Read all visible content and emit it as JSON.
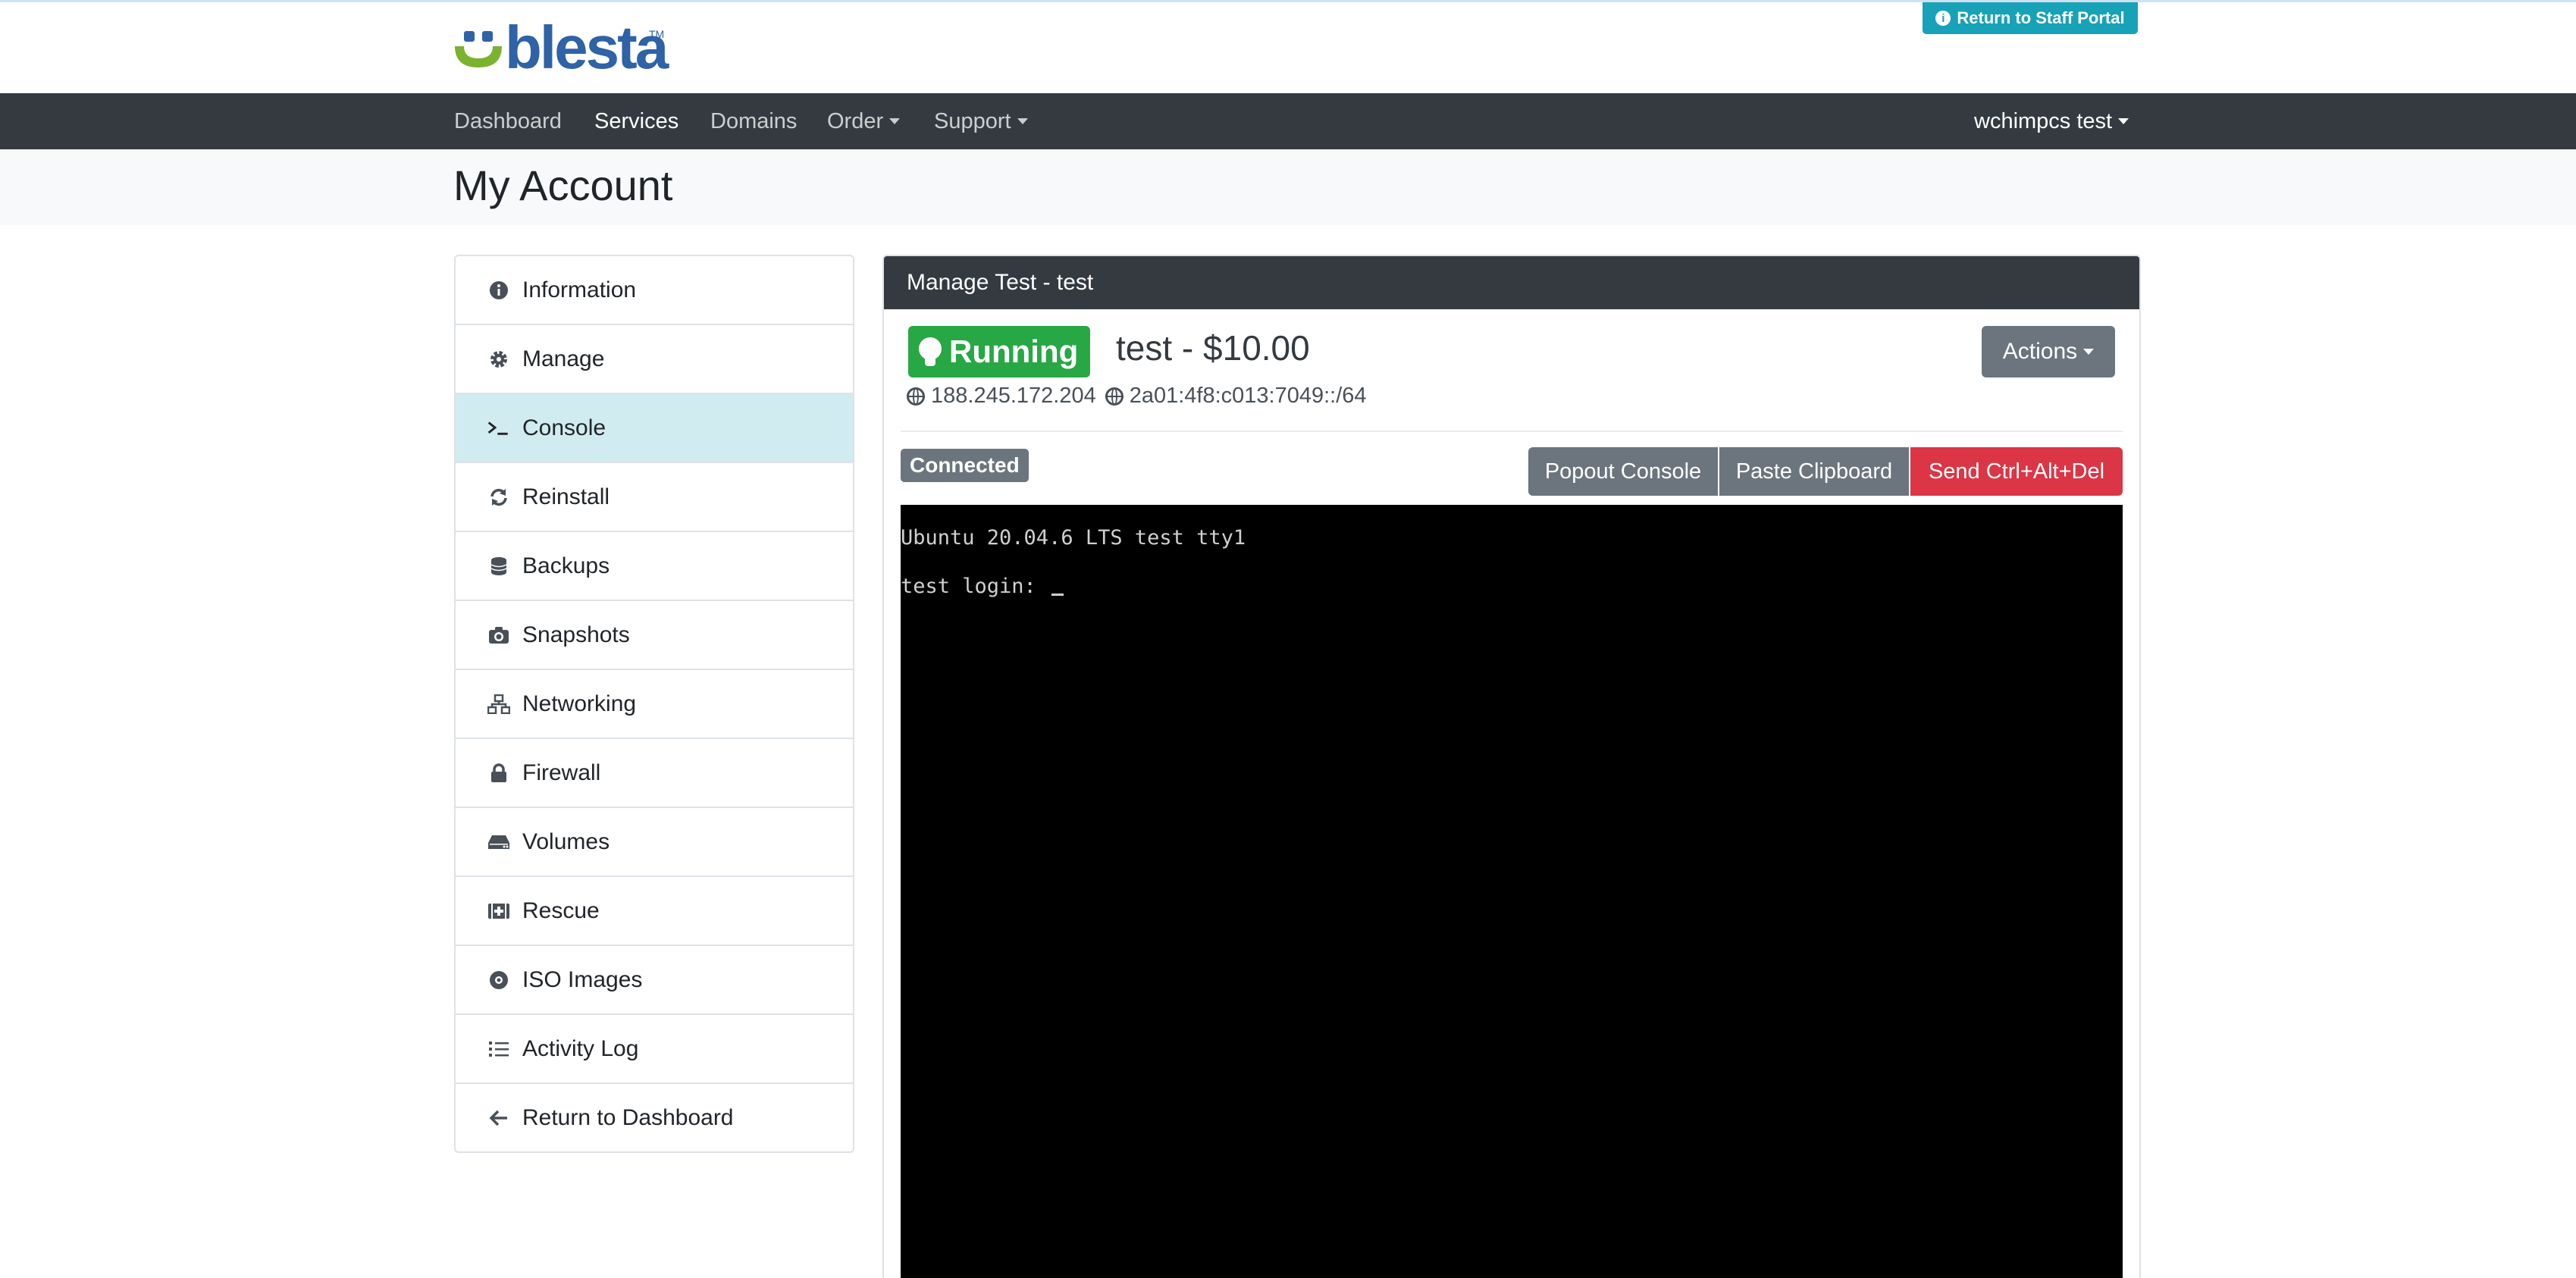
{
  "header": {
    "logo_text": "blesta",
    "logo_tm": "TM",
    "staff_portal_label": "Return to Staff Portal",
    "brand_colors": {
      "logo_blue": "#2f62a6",
      "logo_green": "#7ab32e",
      "staff_button": "#17a2b8"
    }
  },
  "nav": {
    "items": [
      {
        "label": "Dashboard"
      },
      {
        "label": "Services"
      },
      {
        "label": "Domains"
      },
      {
        "label": "Order"
      },
      {
        "label": "Support"
      }
    ],
    "user_label": "wchimpcs test"
  },
  "page": {
    "title": "My Account"
  },
  "sidebar": {
    "items": [
      {
        "label": "Information",
        "icon": "info-circle-icon"
      },
      {
        "label": "Manage",
        "icon": "gear-icon"
      },
      {
        "label": "Console",
        "icon": "terminal-icon"
      },
      {
        "label": "Reinstall",
        "icon": "sync-icon"
      },
      {
        "label": "Backups",
        "icon": "database-icon"
      },
      {
        "label": "Snapshots",
        "icon": "camera-icon"
      },
      {
        "label": "Networking",
        "icon": "network-icon"
      },
      {
        "label": "Firewall",
        "icon": "lock-icon"
      },
      {
        "label": "Volumes",
        "icon": "hdd-icon"
      },
      {
        "label": "Rescue",
        "icon": "first-aid-icon"
      },
      {
        "label": "ISO Images",
        "icon": "compact-disc-icon"
      },
      {
        "label": "Activity Log",
        "icon": "list-icon"
      },
      {
        "label": "Return to Dashboard",
        "icon": "arrow-left-icon"
      }
    ],
    "active": "Console"
  },
  "panel": {
    "header": "Manage Test - test",
    "status": "Running",
    "service_title": "test - $10.00",
    "ipv4": "188.245.172.204",
    "ipv6": "2a01:4f8:c013:7049::/64",
    "actions_label": "Actions",
    "colors": {
      "running": "#28a745",
      "danger": "#dc3545",
      "secondary": "#6c757d"
    }
  },
  "console": {
    "connection_status": "Connected",
    "popout_label": "Popout Console",
    "paste_label": "Paste Clipboard",
    "ctrl_alt_del_label": "Send Ctrl+Alt+Del",
    "lines": [
      "Ubuntu 20.04.6 LTS test tty1",
      "test login: "
    ]
  }
}
